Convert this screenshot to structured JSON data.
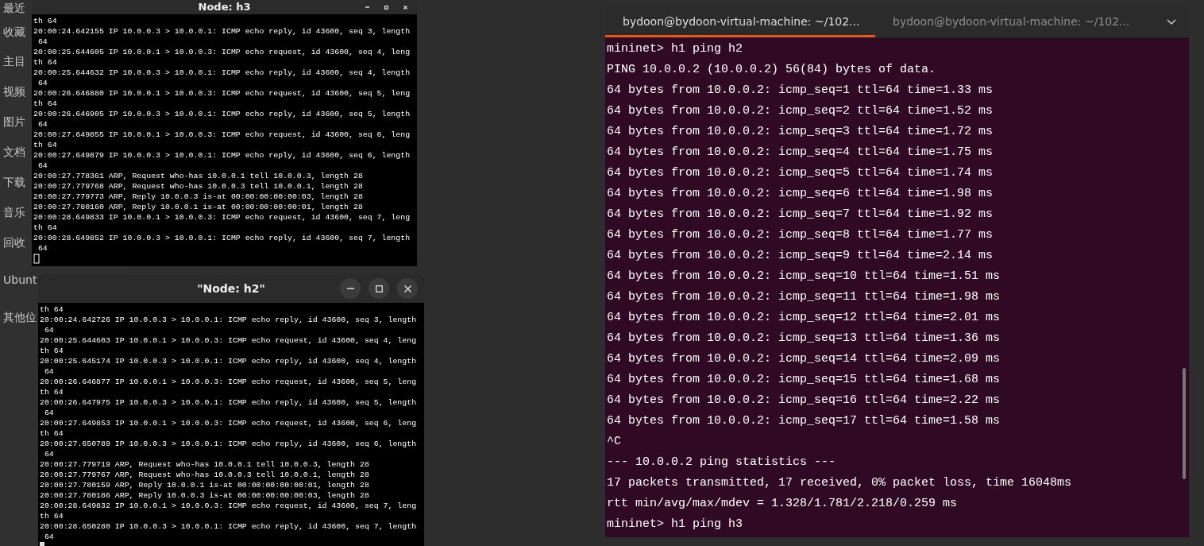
{
  "file_manager_sidebar": {
    "items": [
      {
        "label": "最近"
      },
      {
        "label": "收藏"
      },
      {
        "label": "主目"
      },
      {
        "label": "视频"
      },
      {
        "label": "图片"
      },
      {
        "label": "文档"
      },
      {
        "label": "下载"
      },
      {
        "label": "音乐"
      },
      {
        "label": "回收"
      },
      {
        "label": "Ubunt"
      },
      {
        "label": "其他位"
      }
    ]
  },
  "node_windows": [
    {
      "title": "Node: h3",
      "lines": [
        "th 64",
        "20:00:24.642155 IP 10.0.0.3 > 10.0.0.1: ICMP echo reply, id 43600, seq 3, length",
        " 64",
        "20:00:25.644605 IP 10.0.0.1 > 10.0.0.3: ICMP echo request, id 43600, seq 4, leng",
        "th 64",
        "20:00:25.644632 IP 10.0.0.3 > 10.0.0.1: ICMP echo reply, id 43600, seq 4, length",
        " 64",
        "20:00:26.646880 IP 10.0.0.1 > 10.0.0.3: ICMP echo request, id 43600, seq 5, leng",
        "th 64",
        "20:00:26.646905 IP 10.0.0.3 > 10.0.0.1: ICMP echo reply, id 43600, seq 5, length",
        " 64",
        "20:00:27.649855 IP 10.0.0.1 > 10.0.0.3: ICMP echo request, id 43600, seq 6, leng",
        "th 64",
        "20:00:27.649879 IP 10.0.0.3 > 10.0.0.1: ICMP echo reply, id 43600, seq 6, length",
        " 64",
        "20:00:27.778361 ARP, Request who-has 10.0.0.1 tell 10.0.0.3, length 28",
        "20:00:27.779768 ARP, Request who-has 10.0.0.3 tell 10.0.0.1, length 28",
        "20:00:27.779773 ARP, Reply 10.0.0.3 is-at 00:00:00:00:00:03, length 28",
        "20:00:27.780160 ARP, Reply 10.0.0.1 is-at 00:00:00:00:00:01, length 28",
        "20:00:28.649833 IP 10.0.0.1 > 10.0.0.3: ICMP echo request, id 43600, seq 7, leng",
        "th 64",
        "20:00:28.649852 IP 10.0.0.3 > 10.0.0.1: ICMP echo reply, id 43600, seq 7, length",
        " 64"
      ]
    },
    {
      "title": "\"Node: h2\"",
      "lines": [
        "th 64",
        "20:00:24.642726 IP 10.0.0.3 > 10.0.0.1: ICMP echo reply, id 43600, seq 3, length",
        " 64",
        "20:00:25.644603 IP 10.0.0.1 > 10.0.0.3: ICMP echo request, id 43600, seq 4, leng",
        "th 64",
        "20:00:25.645174 IP 10.0.0.3 > 10.0.0.1: ICMP echo reply, id 43600, seq 4, length",
        " 64",
        "20:00:26.646877 IP 10.0.0.1 > 10.0.0.3: ICMP echo request, id 43600, seq 5, leng",
        "th 64",
        "20:00:26.647975 IP 10.0.0.3 > 10.0.0.1: ICMP echo reply, id 43600, seq 5, length",
        " 64",
        "20:00:27.649853 IP 10.0.0.1 > 10.0.0.3: ICMP echo request, id 43600, seq 6, leng",
        "th 64",
        "20:00:27.650789 IP 10.0.0.3 > 10.0.0.1: ICMP echo reply, id 43600, seq 6, length",
        " 64",
        "20:00:27.779719 ARP, Request who-has 10.0.0.1 tell 10.0.0.3, length 28",
        "20:00:27.779767 ARP, Request who-has 10.0.0.3 tell 10.0.0.1, length 28",
        "20:00:27.780159 ARP, Reply 10.0.0.1 is-at 00:00:00:00:00:01, length 28",
        "20:00:27.780186 ARP, Reply 10.0.0.3 is-at 00:00:00:00:00:03, length 28",
        "20:00:28.649832 IP 10.0.0.1 > 10.0.0.3: ICMP echo request, id 43600, seq 7, leng",
        "th 64",
        "20:00:28.650280 IP 10.0.0.3 > 10.0.0.1: ICMP echo reply, id 43600, seq 7, length",
        " 64"
      ]
    }
  ],
  "terminal": {
    "tabs": [
      {
        "label": "bydoon@bydoon-virtual-machine: ~/102...",
        "selected": true
      },
      {
        "label": "bydoon@bydoon-virtual-machine: ~/102...",
        "selected": false
      }
    ],
    "lines": [
      "mininet> h1 ping h2",
      "PING 10.0.0.2 (10.0.0.2) 56(84) bytes of data.",
      "64 bytes from 10.0.0.2: icmp_seq=1 ttl=64 time=1.33 ms",
      "64 bytes from 10.0.0.2: icmp_seq=2 ttl=64 time=1.52 ms",
      "64 bytes from 10.0.0.2: icmp_seq=3 ttl=64 time=1.72 ms",
      "64 bytes from 10.0.0.2: icmp_seq=4 ttl=64 time=1.75 ms",
      "64 bytes from 10.0.0.2: icmp_seq=5 ttl=64 time=1.74 ms",
      "64 bytes from 10.0.0.2: icmp_seq=6 ttl=64 time=1.98 ms",
      "64 bytes from 10.0.0.2: icmp_seq=7 ttl=64 time=1.92 ms",
      "64 bytes from 10.0.0.2: icmp_seq=8 ttl=64 time=1.77 ms",
      "64 bytes from 10.0.0.2: icmp_seq=9 ttl=64 time=2.14 ms",
      "64 bytes from 10.0.0.2: icmp_seq=10 ttl=64 time=1.51 ms",
      "64 bytes from 10.0.0.2: icmp_seq=11 ttl=64 time=1.98 ms",
      "64 bytes from 10.0.0.2: icmp_seq=12 ttl=64 time=2.01 ms",
      "64 bytes from 10.0.0.2: icmp_seq=13 ttl=64 time=1.36 ms",
      "64 bytes from 10.0.0.2: icmp_seq=14 ttl=64 time=2.09 ms",
      "64 bytes from 10.0.0.2: icmp_seq=15 ttl=64 time=1.68 ms",
      "64 bytes from 10.0.0.2: icmp_seq=16 ttl=64 time=2.22 ms",
      "64 bytes from 10.0.0.2: icmp_seq=17 ttl=64 time=1.58 ms",
      "^C",
      "--- 10.0.0.2 ping statistics ---",
      "17 packets transmitted, 17 received, 0% packet loss, time 16048ms",
      "rtt min/avg/max/mdev = 1.328/1.781/2.218/0.259 ms",
      "mininet> h1 ping h3"
    ]
  }
}
